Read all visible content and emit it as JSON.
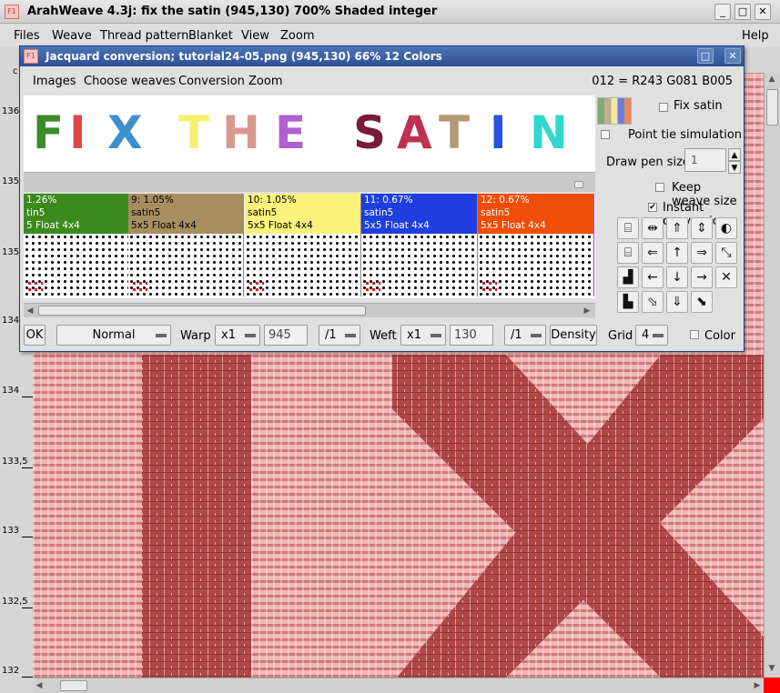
{
  "main_window": {
    "app_icon": "arahweave-icon",
    "title": "ArahWeave 4.3j: fix the satin (945,130) 700% Shaded integer",
    "buttons": {
      "minimize": "_",
      "maximize": "□",
      "close": "✕"
    },
    "menu": [
      "Files",
      "Weave",
      "Thread pattern",
      "Blanket",
      "View",
      "Zoom"
    ],
    "help": "Help"
  },
  "ruler": {
    "labels": [
      "136",
      "135",
      "135",
      "134",
      "134",
      "133,5",
      "133",
      "132,5",
      "132"
    ],
    "left_edge_char": "c"
  },
  "weave_colors": {
    "light": "#f2b6b6",
    "dark": "#b04848",
    "accent_red": "#ff0000"
  },
  "dialog": {
    "title": "Jacquard conversion; tutorial24-05.png (945,130) 66% 12 Colors",
    "menu": [
      "Images",
      "Choose weaves",
      "Conversion",
      "Zoom"
    ],
    "color_info": "012 = R243 G081 B005",
    "preview_text": {
      "letters": [
        {
          "ch": "F",
          "color": "#3c8a2a"
        },
        {
          "ch": "I",
          "color": "#e04848"
        },
        {
          "ch": "X",
          "color": "#3f8ed0"
        },
        {
          "ch": "T",
          "color": "#f6f070"
        },
        {
          "ch": "H",
          "color": "#d89a90"
        },
        {
          "ch": "E",
          "color": "#b060d0"
        },
        {
          "ch": "S",
          "color": "#7a1a3a"
        },
        {
          "ch": "A",
          "color": "#c03050"
        },
        {
          "ch": "T",
          "color": "#b09a70"
        },
        {
          "ch": "I",
          "color": "#2a50e0"
        },
        {
          "ch": "N",
          "color": "#30d8d0"
        }
      ]
    },
    "weaves": [
      {
        "label": "1.26%",
        "weave": "tin5",
        "float": "5 Float 4x4",
        "color": "#3c8a1e",
        "light_text": true,
        "red_marks": true
      },
      {
        "label": "9: 1.05%",
        "weave": "satin5",
        "float": "5x5 Float 4x4",
        "color": "#a88e5e",
        "light_text": false,
        "red_marks": true
      },
      {
        "label": "10: 1.05%",
        "weave": "satin5",
        "float": "5x5 Float 4x4",
        "color": "#fcf27a",
        "light_text": false,
        "red_marks": true
      },
      {
        "label": "11: 0.67%",
        "weave": "satin5",
        "float": "5x5 Float 4x4",
        "color": "#1e3ee0",
        "light_text": true,
        "red_marks": true
      },
      {
        "label": "12: 0.67%",
        "weave": "satin5",
        "float": "5x5 Float 4x4",
        "color": "#f04e08",
        "light_text": true,
        "red_marks": true,
        "selected": true
      }
    ],
    "right_panel": {
      "fix_satin": "Fix satin",
      "point_tie": "Point tie simulation",
      "draw_pen_size_label": "Draw pen size",
      "draw_pen_size_value": "1",
      "keep_weave_size": "Keep weave size",
      "instant_conversion": "Instant conversion",
      "instant_conversion_checked": true,
      "tools": [
        {
          "name": "shift-up-stairs-icon",
          "glyph": "⌸"
        },
        {
          "name": "stretch-horizontal-icon",
          "glyph": "⇹"
        },
        {
          "name": "double-up-icon",
          "glyph": "⇑"
        },
        {
          "name": "flip-vertical-icon",
          "glyph": "⇕"
        },
        {
          "name": "invert-icon",
          "glyph": "◐"
        },
        {
          "name": "shift-down-stairs-icon",
          "glyph": "⌸"
        },
        {
          "name": "double-left-icon",
          "glyph": "⇐"
        },
        {
          "name": "arrow-up-icon",
          "glyph": "↑"
        },
        {
          "name": "double-right-icon",
          "glyph": "⇒"
        },
        {
          "name": "diagonal-arrows-icon",
          "glyph": "⤡"
        },
        {
          "name": "stairs-up-icon",
          "glyph": "▟"
        },
        {
          "name": "arrow-left-icon",
          "glyph": "←"
        },
        {
          "name": "arrow-down-icon",
          "glyph": "↓"
        },
        {
          "name": "arrow-right-icon",
          "glyph": "→"
        },
        {
          "name": "cross-icon",
          "glyph": "✕"
        },
        {
          "name": "stairs-down-icon",
          "glyph": "▙"
        },
        {
          "name": "diagonal-shift-icon",
          "glyph": "⬂"
        },
        {
          "name": "double-down-icon",
          "glyph": "⇓"
        },
        {
          "name": "diagonal-shift-2-icon",
          "glyph": "⬊"
        }
      ]
    },
    "bottom": {
      "ok": "OK",
      "mode": "Normal",
      "warp_label": "Warp",
      "warp_mult": "x1",
      "warp_value": "945",
      "warp_div": "/1",
      "weft_label": "Weft",
      "weft_mult": "x1",
      "weft_value": "130",
      "weft_div": "/1",
      "density": "Density",
      "grid_label": "Grid",
      "grid_value": "4",
      "color_label": "Color"
    }
  }
}
